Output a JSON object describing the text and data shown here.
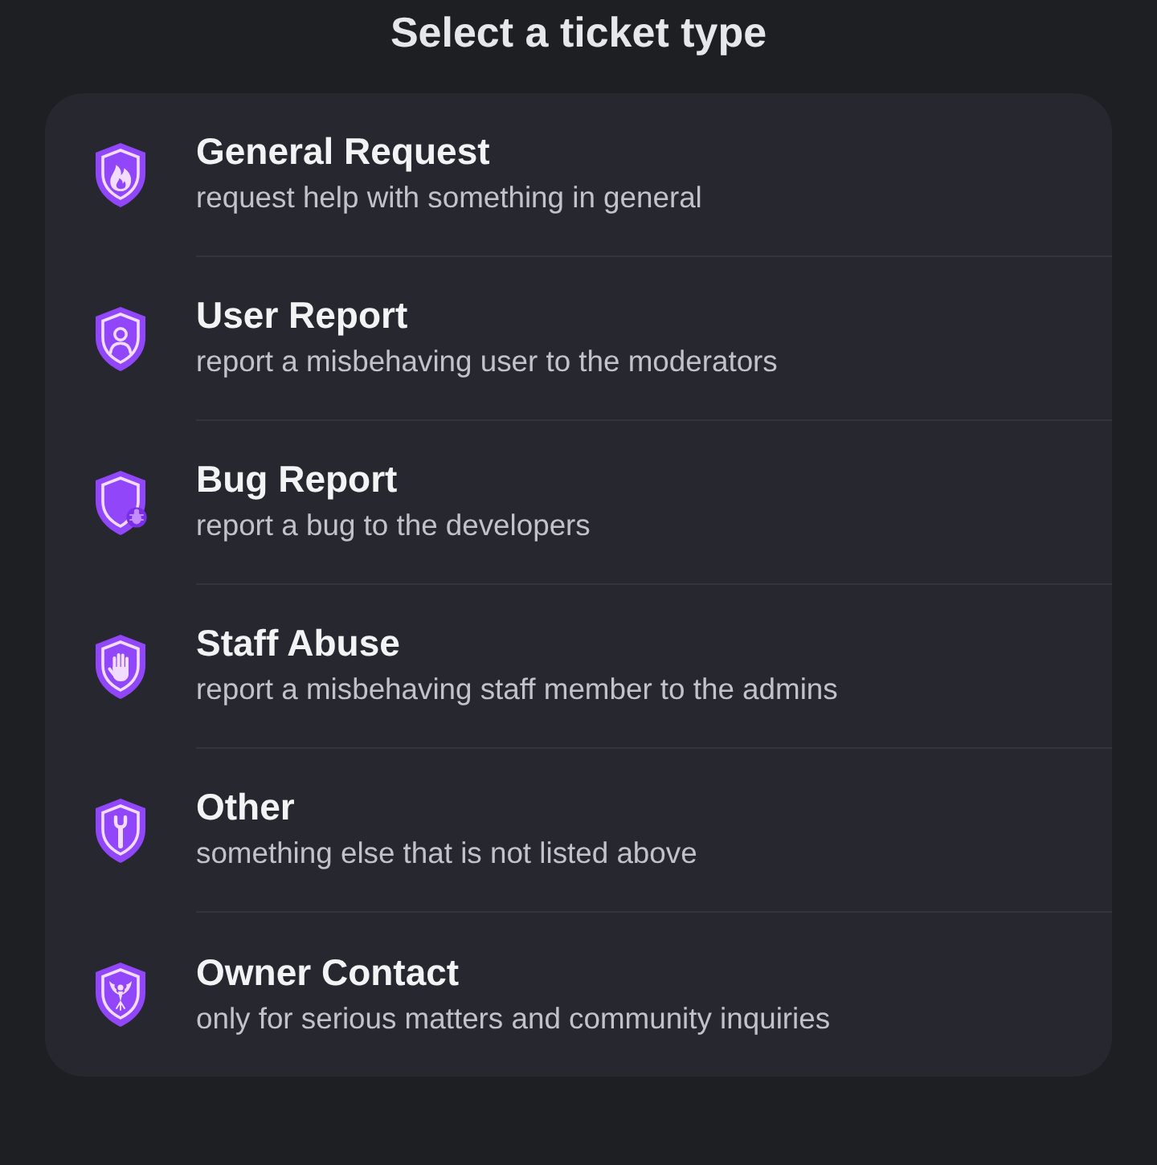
{
  "title": "Select a ticket type",
  "options": [
    {
      "title": "General Request",
      "description": "request help with something in general"
    },
    {
      "title": "User Report",
      "description": "report a misbehaving user to the moderators"
    },
    {
      "title": "Bug Report",
      "description": "report a bug to the developers"
    },
    {
      "title": "Staff Abuse",
      "description": "report a misbehaving staff member to the admins"
    },
    {
      "title": "Other",
      "description": "something else that is not listed above"
    },
    {
      "title": "Owner Contact",
      "description": "only for serious matters and community inquiries"
    }
  ]
}
